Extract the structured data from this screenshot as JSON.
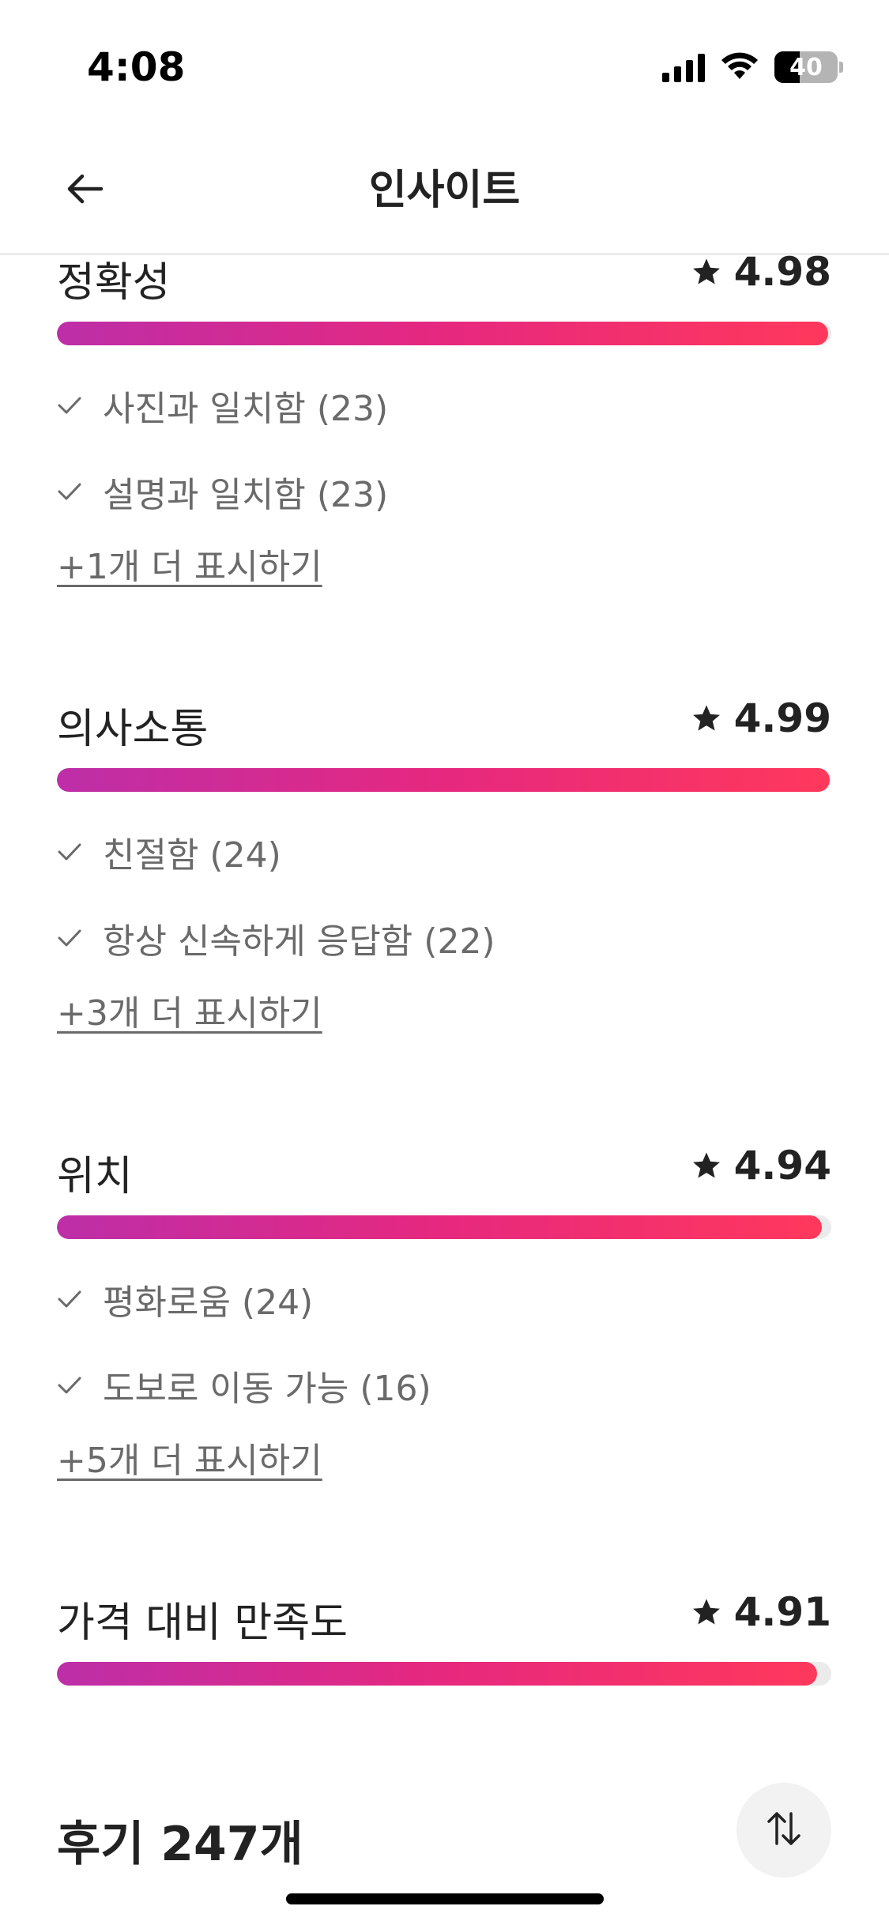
{
  "status_bar": {
    "time": "4:08",
    "battery": "40",
    "battery_level": 0.4
  },
  "header": {
    "title": "인사이트",
    "back_icon": "arrow-left-icon"
  },
  "categories": [
    {
      "title": "정확성",
      "rating": "4.98",
      "rating_fraction": 0.996,
      "highlights": [
        "사진과 일치함 (23)",
        "설명과 일치함 (23)"
      ],
      "show_more": "+1개 더 표시하기"
    },
    {
      "title": "의사소통",
      "rating": "4.99",
      "rating_fraction": 0.998,
      "highlights": [
        "친절함 (24)",
        "항상 신속하게 응답함 (22)"
      ],
      "show_more": "+3개 더 표시하기"
    },
    {
      "title": "위치",
      "rating": "4.94",
      "rating_fraction": 0.988,
      "highlights": [
        "평화로움 (24)",
        "도보로 이동 가능 (16)"
      ],
      "show_more": "+5개 더 표시하기"
    },
    {
      "title": "가격 대비 만족도",
      "rating": "4.91",
      "rating_fraction": 0.982,
      "highlights": [],
      "show_more": ""
    }
  ],
  "reviews": {
    "title": "후기 247개",
    "sort_icon": "sort-arrows-icon"
  },
  "colors": {
    "bar_gradient_start": "#bd2ea8",
    "bar_gradient_end": "#ff385c",
    "text_primary": "#222222",
    "text_secondary": "#6a6a6a"
  }
}
